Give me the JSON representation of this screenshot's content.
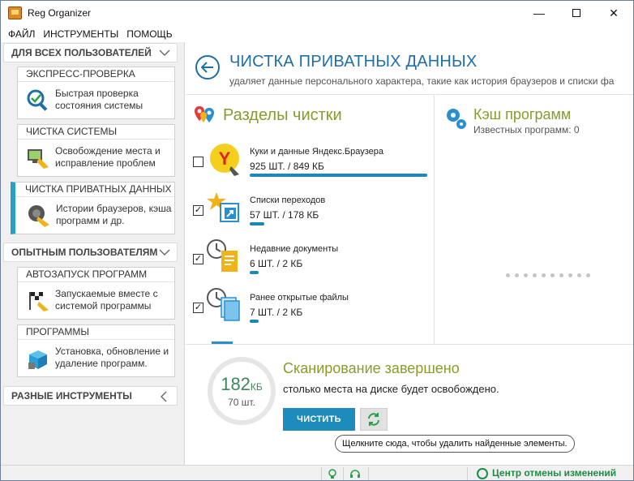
{
  "window": {
    "title": "Reg Organizer"
  },
  "menu": [
    "ФАЙЛ",
    "ИНСТРУМЕНТЫ",
    "ПОМОЩЬ"
  ],
  "sidebar": {
    "group_all": "ДЛЯ ВСЕХ ПОЛЬЗОВАТЕЛЕЙ",
    "group_adv": "ОПЫТНЫМ ПОЛЬЗОВАТЕЛЯМ",
    "group_misc": "РАЗНЫЕ ИНСТРУМЕНТЫ",
    "cards": [
      {
        "title": "ЭКСПРЕСС-ПРОВЕРКА",
        "text": "Быстрая проверка состояния системы",
        "icon": "magnifier-check-icon"
      },
      {
        "title": "ЧИСТКА СИСТЕМЫ",
        "text": "Освобождение места и исправление проблем",
        "icon": "system-clean-icon"
      },
      {
        "title": "ЧИСТКА ПРИВАТНЫХ ДАННЫХ",
        "text": "Истории браузеров, кэша программ и др.",
        "icon": "privacy-clean-icon"
      },
      {
        "title": "АВТОЗАПУСК ПРОГРАММ",
        "text": "Запускаемые вместе с системой программы",
        "icon": "autostart-flag-icon"
      },
      {
        "title": "ПРОГРАММЫ",
        "text": "Установка, обновление и удаление программ.",
        "icon": "programs-box-icon"
      }
    ]
  },
  "main": {
    "title": "ЧИСТКА ПРИВАТНЫХ ДАННЫХ",
    "subtitle": "удаляет данные персонального характера, такие как история браузеров и списки фа",
    "sections_title": "Разделы чистки",
    "items": [
      {
        "name": "Куки и данные Яндекс.Браузера",
        "count": "925 ШТ. / 849 КБ",
        "checked": false,
        "check_mark": "",
        "bar": 1.0
      },
      {
        "name": "Списки переходов",
        "count": "57 ШТ. / 178 КБ",
        "checked": true,
        "check_mark": "✓",
        "bar": 0.08
      },
      {
        "name": "Недавние документы",
        "count": "6 ШТ. / 2 КБ",
        "checked": true,
        "check_mark": "✓",
        "bar": 0.05
      },
      {
        "name": "Ранее открытые файлы",
        "count": "7 ШТ. / 2 КБ",
        "checked": true,
        "check_mark": "✓",
        "bar": 0.05
      }
    ],
    "cache_title": "Кэш программ",
    "cache_sub": "Известных программ: 0",
    "scan": {
      "size_value": "182",
      "size_unit": "КБ",
      "items_count": "70 шт.",
      "title": "Сканирование завершено",
      "desc": "столько места на диске будет освобождено.",
      "clean_label": "ЧИСТИТЬ",
      "hint": "Щелкните сюда, чтобы удалить найденные элементы."
    }
  },
  "statusbar": {
    "undo_label": "Центр отмены изменений"
  },
  "colors": {
    "accent": "#1e6fa8",
    "green_title": "#8a9a2c",
    "button": "#1d8bbb"
  }
}
